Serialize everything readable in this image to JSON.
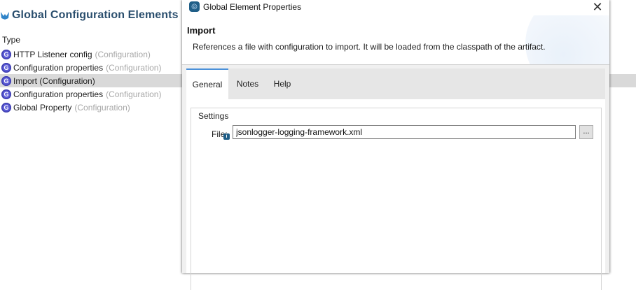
{
  "background_editor": {
    "title": "Global Configuration Elements",
    "type_column_header": "Type",
    "items": [
      {
        "name": "HTTP Listener config",
        "type": "(Configuration)",
        "selected": false
      },
      {
        "name": "Configuration properties",
        "type": "(Configuration)",
        "selected": false
      },
      {
        "name": "Import (Configuration)",
        "type": "",
        "selected": true
      },
      {
        "name": "Configuration properties",
        "type": "(Configuration)",
        "selected": false
      },
      {
        "name": "Global Property",
        "type": "(Configuration)",
        "selected": false
      }
    ]
  },
  "dialog": {
    "title": "Global Element Properties",
    "close_glyph": "✕",
    "banner_title": "Import",
    "banner_description": "References a file with configuration to import. It will be loaded from the classpath of the artifact.",
    "tabs": [
      {
        "label": "General",
        "active": true
      },
      {
        "label": "Notes",
        "active": false
      },
      {
        "label": "Help",
        "active": false
      }
    ],
    "settings_group_label": "Settings",
    "file_label": "File:",
    "file_value": "jsonlogger-logging-framework.xml",
    "browse_label": "...",
    "info_glyph": "i"
  },
  "colors": {
    "accent": "#4a90d9",
    "selection": "#d9d9d9",
    "global_icon": "#5b5bd6"
  },
  "icons": [
    "mule-logo-icon",
    "global-element-icon",
    "app-icon",
    "close-icon",
    "info-icon"
  ]
}
